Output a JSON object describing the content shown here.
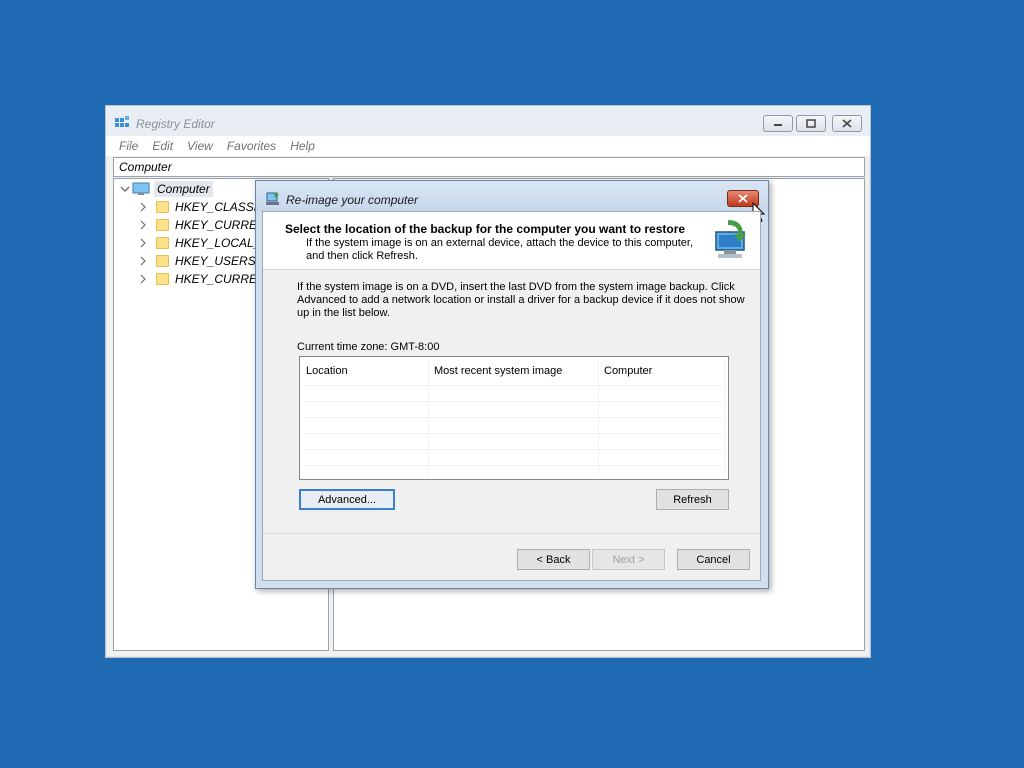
{
  "registry": {
    "title": "Registry Editor",
    "menu": [
      "File",
      "Edit",
      "View",
      "Favorites",
      "Help"
    ],
    "address": "Computer",
    "tree": {
      "root": "Computer",
      "children": [
        "HKEY_CLASSES_",
        "HKEY_CURRENT_",
        "HKEY_LOCAL_M",
        "HKEY_USERS",
        "HKEY_CURRENT_"
      ]
    }
  },
  "dialog": {
    "title": "Re-image your computer",
    "heading": "Select the location of the backup for the computer you want to restore",
    "subtext": "If the system image is on an external device, attach the device to this computer, and then click Refresh.",
    "description": "If the system image is on a DVD, insert the last DVD from the system image backup. Click Advanced to add a network location or install a driver for a backup device if it does not show up in the list below.",
    "timezone": "Current time zone: GMT-8:00",
    "table": {
      "columns": [
        "Location",
        "Most recent system image",
        "Computer"
      ],
      "rows": []
    },
    "buttons": {
      "advanced": "Advanced...",
      "refresh": "Refresh",
      "back": "< Back",
      "next": "Next >",
      "cancel": "Cancel"
    }
  },
  "colors": {
    "desktop": "#1f6ab2",
    "close_button": "#c0391b",
    "focus_border": "#3c7fd1"
  }
}
